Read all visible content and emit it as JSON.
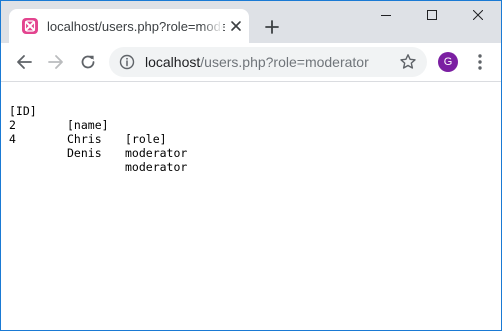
{
  "browser": {
    "tab": {
      "title": "localhost/users.php?role=moderator",
      "favicon": "xampp-icon"
    },
    "address_bar": {
      "host": "localhost",
      "path": "/users.php?role=moderator"
    },
    "profile_initial": "G",
    "colors": {
      "tabstrip": "#dee1e6",
      "favicon": "#e3448f",
      "avatar": "#7b1fa2",
      "omnibox": "#f1f3f4"
    }
  },
  "page": {
    "table": {
      "headers": [
        "[ID]",
        "[name]",
        "[role]"
      ],
      "rows": [
        [
          "2",
          "Chris",
          "moderator"
        ],
        [
          "4",
          "Denis",
          "moderator"
        ]
      ]
    }
  }
}
